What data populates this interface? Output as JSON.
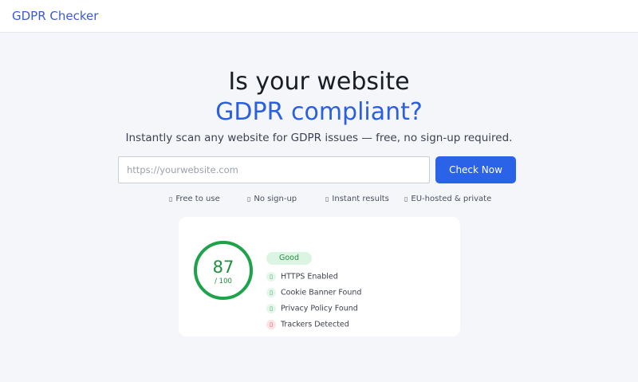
{
  "header": {
    "brand": "GDPR Checker"
  },
  "hero": {
    "title_line1": "Is your website",
    "title_line2": "GDPR compliant?",
    "subtitle": "Instantly scan any website for GDPR issues — free, no sign-up required."
  },
  "search": {
    "placeholder": "https://yourwebsite.com",
    "value": "",
    "button_label": "Check Now"
  },
  "features": [
    {
      "icon": "check-icon",
      "label": "Free to use"
    },
    {
      "icon": "check-icon",
      "label": "No sign-up"
    },
    {
      "icon": "check-icon",
      "label": "Instant results"
    },
    {
      "icon": "check-icon",
      "label": "EU-hosted & private"
    }
  ],
  "result": {
    "score": "87",
    "score_max": "/ 100",
    "score_fraction": 0.87,
    "badge": "Good",
    "checks": [
      {
        "label": "HTTPS Enabled",
        "status": "pass",
        "icon": "check-icon"
      },
      {
        "label": "Cookie Banner Found",
        "status": "pass",
        "icon": "check-icon"
      },
      {
        "label": "Privacy Policy Found",
        "status": "pass",
        "icon": "check-icon"
      },
      {
        "label": "Trackers Detected",
        "status": "fail",
        "icon": "warning-icon"
      }
    ]
  },
  "colors": {
    "accent": "#2a62e8",
    "good": "#1fa34a",
    "warn": "#d04646"
  }
}
